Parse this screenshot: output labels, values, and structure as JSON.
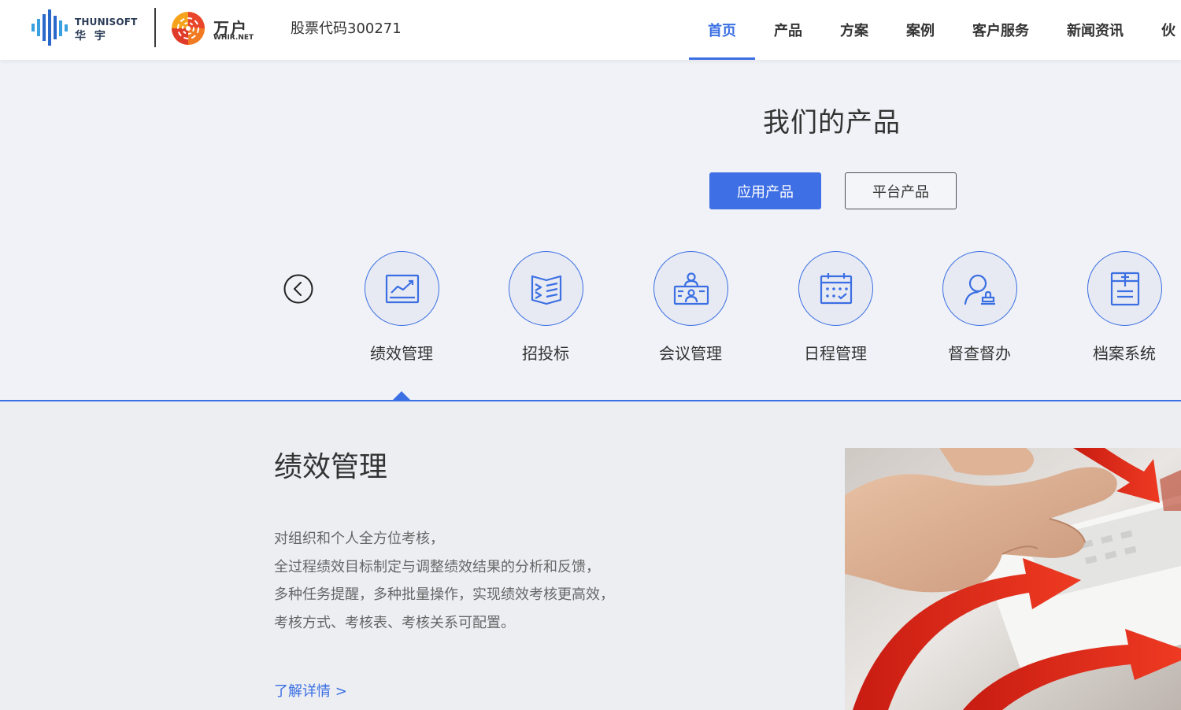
{
  "header": {
    "logo_en": "THUNISOFT",
    "logo_cn": "华 宇",
    "partner_logo_cn": "万户",
    "partner_logo_en": "WHIR.NET",
    "stock_code": "股票代码300271",
    "nav": [
      {
        "label": "首页",
        "active": true
      },
      {
        "label": "产品"
      },
      {
        "label": "方案"
      },
      {
        "label": "案例"
      },
      {
        "label": "客户服务"
      },
      {
        "label": "新闻资讯"
      },
      {
        "label": "伙"
      }
    ]
  },
  "products": {
    "title": "我们的产品",
    "tabs": [
      {
        "label": "应用产品",
        "active": true
      },
      {
        "label": "平台产品"
      }
    ],
    "items": [
      {
        "label": "绩效管理",
        "icon": "chart-icon"
      },
      {
        "label": "招投标",
        "icon": "book-icon"
      },
      {
        "label": "会议管理",
        "icon": "meeting-icon"
      },
      {
        "label": "日程管理",
        "icon": "calendar-icon"
      },
      {
        "label": "督查督办",
        "icon": "user-stamp-icon"
      },
      {
        "label": "档案系统",
        "icon": "archive-icon"
      }
    ]
  },
  "detail": {
    "title": "绩效管理",
    "lines": [
      "对组织和个人全方位考核，",
      "全过程绩效目标制定与调整绩效结果的分析和反馈，",
      "多种任务提醒，多种批量操作，实现绩效考核更高效，",
      "考核方式、考核表、考核关系可配置。"
    ],
    "link": "了解详情 >"
  },
  "colors": {
    "accent": "#3b6fe3",
    "background": "#f0f2f7",
    "text": "#333333"
  }
}
